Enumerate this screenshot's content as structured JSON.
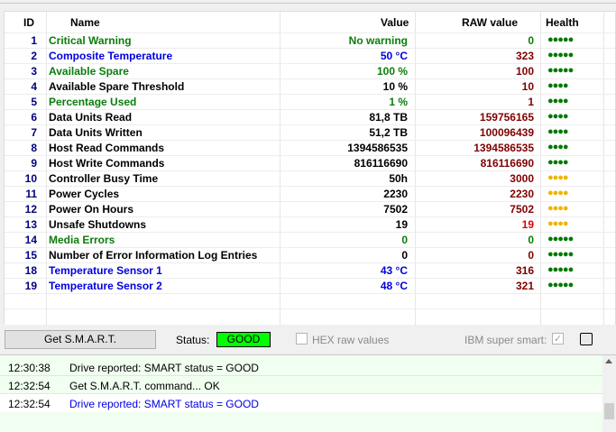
{
  "table": {
    "headers": {
      "id": "ID",
      "name": "Name",
      "value": "Value",
      "raw": "RAW value",
      "health": "Health"
    },
    "rows": [
      {
        "id": "1",
        "name": "Critical Warning",
        "value": "No warning",
        "raw": "0",
        "health": "●●●●●",
        "name_color": "green",
        "raw_color": "green",
        "health_color": "green"
      },
      {
        "id": "2",
        "name": "Composite Temperature",
        "value": "50 °C",
        "raw": "323",
        "health": "●●●●●",
        "name_color": "blue",
        "raw_color": "dark",
        "health_color": "green"
      },
      {
        "id": "3",
        "name": "Available Spare",
        "value": "100 %",
        "raw": "100",
        "health": "●●●●●",
        "name_color": "green",
        "raw_color": "dark",
        "health_color": "green"
      },
      {
        "id": "4",
        "name": "Available Spare Threshold",
        "value": "10 %",
        "raw": "10",
        "health": "●●●●",
        "name_color": "black",
        "raw_color": "dark",
        "health_color": "green"
      },
      {
        "id": "5",
        "name": "Percentage Used",
        "value": "1 %",
        "raw": "1",
        "health": "●●●●",
        "name_color": "green",
        "raw_color": "dark",
        "health_color": "green"
      },
      {
        "id": "6",
        "name": "Data Units Read",
        "value": "81,8 TB",
        "raw": "159756165",
        "health": "●●●●",
        "name_color": "black",
        "raw_color": "dark",
        "health_color": "green"
      },
      {
        "id": "7",
        "name": "Data Units Written",
        "value": "51,2 TB",
        "raw": "100096439",
        "health": "●●●●",
        "name_color": "black",
        "raw_color": "dark",
        "health_color": "green"
      },
      {
        "id": "8",
        "name": "Host Read Commands",
        "value": "1394586535",
        "raw": "1394586535",
        "health": "●●●●",
        "name_color": "black",
        "raw_color": "dark",
        "health_color": "green"
      },
      {
        "id": "9",
        "name": "Host Write Commands",
        "value": "816116690",
        "raw": "816116690",
        "health": "●●●●",
        "name_color": "black",
        "raw_color": "dark",
        "health_color": "green"
      },
      {
        "id": "10",
        "name": "Controller Busy Time",
        "value": "50h",
        "raw": "3000",
        "health": "●●●●",
        "name_color": "black",
        "raw_color": "dark",
        "health_color": "yellow"
      },
      {
        "id": "11",
        "name": "Power Cycles",
        "value": "2230",
        "raw": "2230",
        "health": "●●●●",
        "name_color": "black",
        "raw_color": "dark",
        "health_color": "yellow"
      },
      {
        "id": "12",
        "name": "Power On Hours",
        "value": "7502",
        "raw": "7502",
        "health": "●●●●",
        "name_color": "black",
        "raw_color": "dark",
        "health_color": "yellow"
      },
      {
        "id": "13",
        "name": "Unsafe Shutdowns",
        "value": "19",
        "raw": "19",
        "health": "●●●●",
        "name_color": "black",
        "raw_color": "red",
        "health_color": "yellow"
      },
      {
        "id": "14",
        "name": "Media Errors",
        "value": "0",
        "raw": "0",
        "health": "●●●●●",
        "name_color": "green",
        "raw_color": "green",
        "health_color": "green"
      },
      {
        "id": "15",
        "name": "Number of Error Information Log Entries",
        "value": "0",
        "raw": "0",
        "health": "●●●●●",
        "name_color": "black",
        "raw_color": "dark",
        "health_color": "green"
      },
      {
        "id": "18",
        "name": "Temperature Sensor 1",
        "value": "43 °C",
        "raw": "316",
        "health": "●●●●●",
        "name_color": "blue",
        "raw_color": "dark",
        "health_color": "green"
      },
      {
        "id": "19",
        "name": "Temperature Sensor 2",
        "value": "48 °C",
        "raw": "321",
        "health": "●●●●●",
        "name_color": "blue",
        "raw_color": "dark",
        "health_color": "green"
      }
    ]
  },
  "toolbar": {
    "get_smart_label": "Get S.M.A.R.T.",
    "status_label": "Status:",
    "status_value": "GOOD",
    "status_color": "#00ff00",
    "hex_label": "HEX raw values",
    "hex_checked": false,
    "ibm_label": "IBM super smart:",
    "ibm_checked": true
  },
  "log": [
    {
      "time": "12:30:38",
      "message": "Drive reported: SMART status = GOOD",
      "style": "normal"
    },
    {
      "time": "12:32:54",
      "message": "Get S.M.A.R.T. command... OK",
      "style": "normal"
    },
    {
      "time": "12:32:54",
      "message": "Drive reported: SMART status = GOOD",
      "style": "blue"
    }
  ],
  "colors": {
    "name_green": "#0a7d0a",
    "name_blue": "#0000e0",
    "raw_dark": "#7f0000",
    "raw_red": "#e00000",
    "health_green": "#007800",
    "health_yellow": "#f0b400",
    "log_background": "#f0fff0"
  }
}
